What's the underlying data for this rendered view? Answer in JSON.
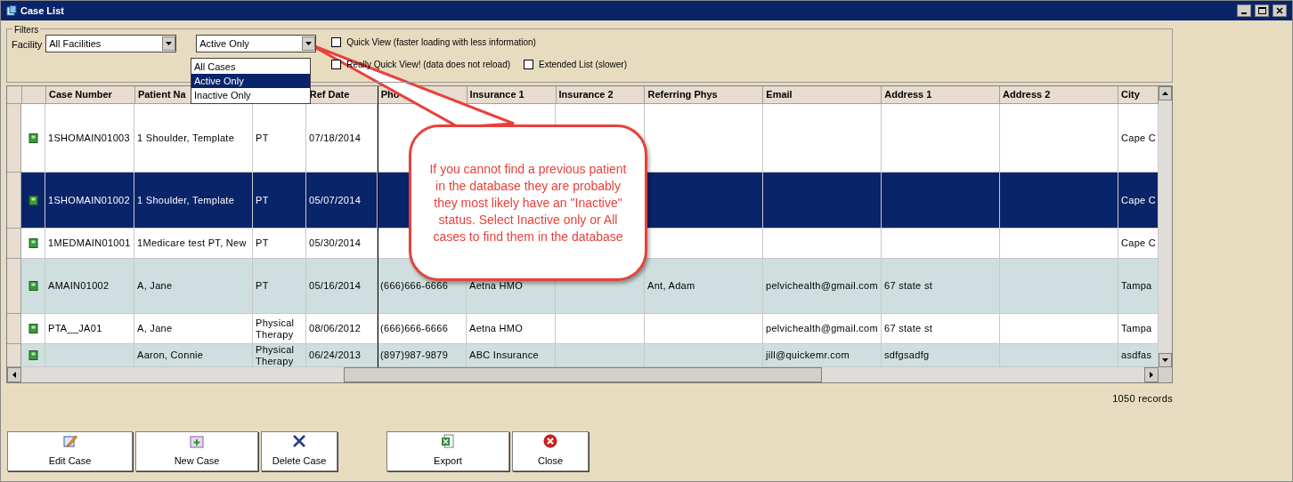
{
  "window": {
    "title": "Case List"
  },
  "filters": {
    "group_label": "Filters",
    "facility_label": "Facility",
    "facility_value": "All Facilities",
    "status_value": "Active Only",
    "status_options": [
      {
        "label": "All Cases",
        "selected": false
      },
      {
        "label": "Active Only",
        "selected": true
      },
      {
        "label": "Inactive Only",
        "selected": false
      }
    ],
    "checkboxes": [
      {
        "label": "Quick View (faster loading with less information)",
        "checked": false
      },
      {
        "label": "Really Quick View! (data does not reload)",
        "checked": false
      },
      {
        "label": "Extended List (slower)",
        "checked": false
      }
    ]
  },
  "table": {
    "columns": [
      "Case Number",
      "Patient Na",
      "Ref Date",
      "Pho",
      "Insurance 1",
      "Insurance 2",
      "Referring Phys",
      "Email",
      "Address 1",
      "Address 2",
      "City"
    ],
    "rows": [
      {
        "selected": false,
        "case_number": "1SHOMAIN01003",
        "patient_name": "1 Shoulder, Template",
        "column_3": "PT",
        "ref_date": "07/18/2014",
        "city": "Cape C"
      },
      {
        "selected": true,
        "case_number": "1SHOMAIN01002",
        "patient_name": "1 Shoulder, Template",
        "column_3": "PT",
        "ref_date": "05/07/2014",
        "city": "Cape C"
      },
      {
        "selected": false,
        "case_number": "1MEDMAIN01001",
        "patient_name": "1Medicare test PT, New",
        "column_3": "PT",
        "ref_date": "05/30/2014",
        "city": "Cape C"
      },
      {
        "selected": false,
        "case_number": "AMAIN01002",
        "patient_name": "A, Jane",
        "column_3": "PT",
        "ref_date": "05/16/2014",
        "phone": "(666)666-6666",
        "insurance_1": "Aetna HMO",
        "referring_phys": "Ant, Adam",
        "email": "pelvichealth@gmail.com",
        "address_1": "67 state st",
        "city": "Tampa"
      },
      {
        "selected": false,
        "case_number": "PTA__JA01",
        "patient_name": "A, Jane",
        "column_3": "Physical Therapy",
        "ref_date": "08/06/2012",
        "phone": "(666)666-6666",
        "insurance_1": "Aetna HMO",
        "email": "pelvichealth@gmail.com",
        "address_1": "67 state st",
        "city": "Tampa"
      },
      {
        "selected": false,
        "patient_name": "Aaron, Connie",
        "column_3": "Physical Therapy",
        "ref_date": "06/24/2013",
        "phone": "(897)987-9879",
        "insurance_1": "ABC Insurance",
        "email": "jill@quickemr.com",
        "address_1": "sdfgsadfg",
        "city": "asdfas"
      }
    ]
  },
  "record_count": "1050 records",
  "callout": "If you cannot find a previous patient in the database they are probably they most likely have an \"Inactive\" status. Select Inactive only or All cases to find them in the database",
  "buttons": [
    {
      "label": "Edit Case",
      "kind": "edit"
    },
    {
      "label": "New Case",
      "kind": "new"
    },
    {
      "label": "Delete Case",
      "kind": "delete"
    },
    {
      "label": "Export",
      "kind": "export"
    },
    {
      "label": "Close",
      "kind": "close"
    }
  ]
}
